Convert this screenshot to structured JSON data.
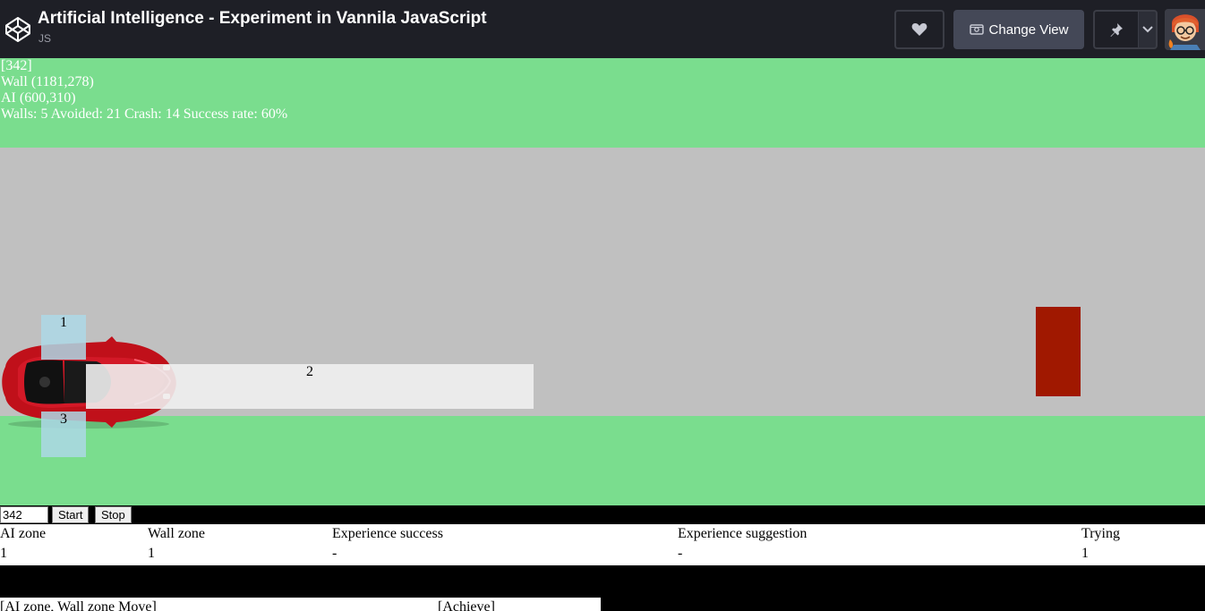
{
  "header": {
    "title": "Artificial Intelligence - Experiment in Vannila JavaScript",
    "subtitle": "JS",
    "change_view_label": "Change View",
    "icons": [
      "codepen-logo-icon",
      "heart-icon",
      "change-view-icon",
      "pin-icon",
      "chevron-down-icon",
      "avatar"
    ]
  },
  "info": {
    "iteration": "[342]",
    "wall": "Wall (1181,278)",
    "ai": "AI (600,310)",
    "stats": "Walls: 5 Avoided: 21 Crash: 14 Success rate: 60%"
  },
  "zones": {
    "zone1": "1",
    "zone2": "2",
    "zone3": "3"
  },
  "controls": {
    "iteration_value": "342",
    "start_label": "Start",
    "stop_label": "Stop"
  },
  "table": {
    "headers": [
      "AI zone",
      "Wall zone",
      "Experience success",
      "Experience suggestion",
      "Trying"
    ],
    "row": [
      "1",
      "1",
      "-",
      "-",
      "1"
    ]
  },
  "bottom": {
    "left_header": "[AI zone, Wall zone Move]",
    "right_header": "[Achieve]"
  },
  "colors": {
    "grass": "#7add8e",
    "road": "#c0c0c0",
    "wall": "#a01800",
    "zone_side": "#add8e6",
    "zone_front": "#f0f0f0",
    "topbar": "#1e1f26"
  }
}
